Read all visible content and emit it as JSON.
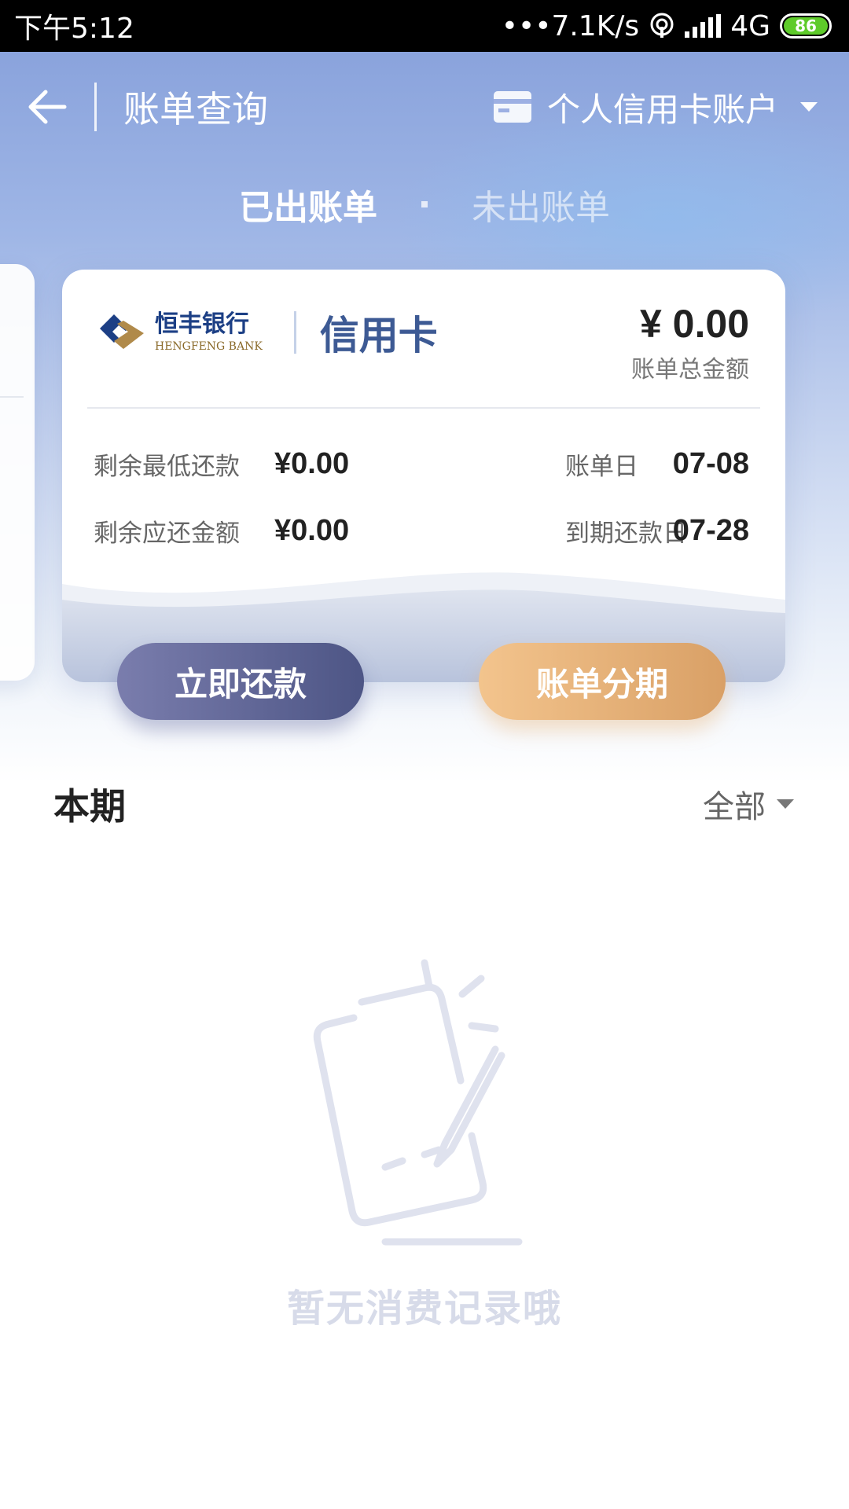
{
  "status_bar": {
    "time": "下午5:12",
    "network_speed": "•••7.1K/s",
    "network_type": "4G",
    "battery": "86",
    "icons": [
      "hotspot-icon",
      "signal-icon",
      "battery-icon"
    ]
  },
  "header": {
    "title": "账单查询",
    "account": "个人信用卡账户"
  },
  "tabs": [
    {
      "label": "已出账单",
      "active": true
    },
    {
      "label": "未出账单",
      "active": false
    }
  ],
  "card": {
    "bank_name_cn": "恒丰银行",
    "bank_name_en": "HENGFENG BANK",
    "card_type": "信用卡",
    "total_amount": "¥ 0.00",
    "total_label": "账单总金额",
    "rows": [
      {
        "label": "剩余最低还款",
        "value": "¥0.00",
        "mid_label": "账单日",
        "mid_value": "07-08"
      },
      {
        "label": "剩余应还金额",
        "value": "¥0.00",
        "mid_label": "到期还款日",
        "mid_value": "07-28"
      }
    ]
  },
  "actions": {
    "repay": "立即还款",
    "installment": "账单分期"
  },
  "section": {
    "title": "本期",
    "filter": "全部"
  },
  "empty_state": {
    "text": "暂无消费记录哦"
  },
  "colors": {
    "accent_blue": "#3d5a94",
    "repay_button": "#5a6090",
    "installment_button": "#e3b07a"
  }
}
